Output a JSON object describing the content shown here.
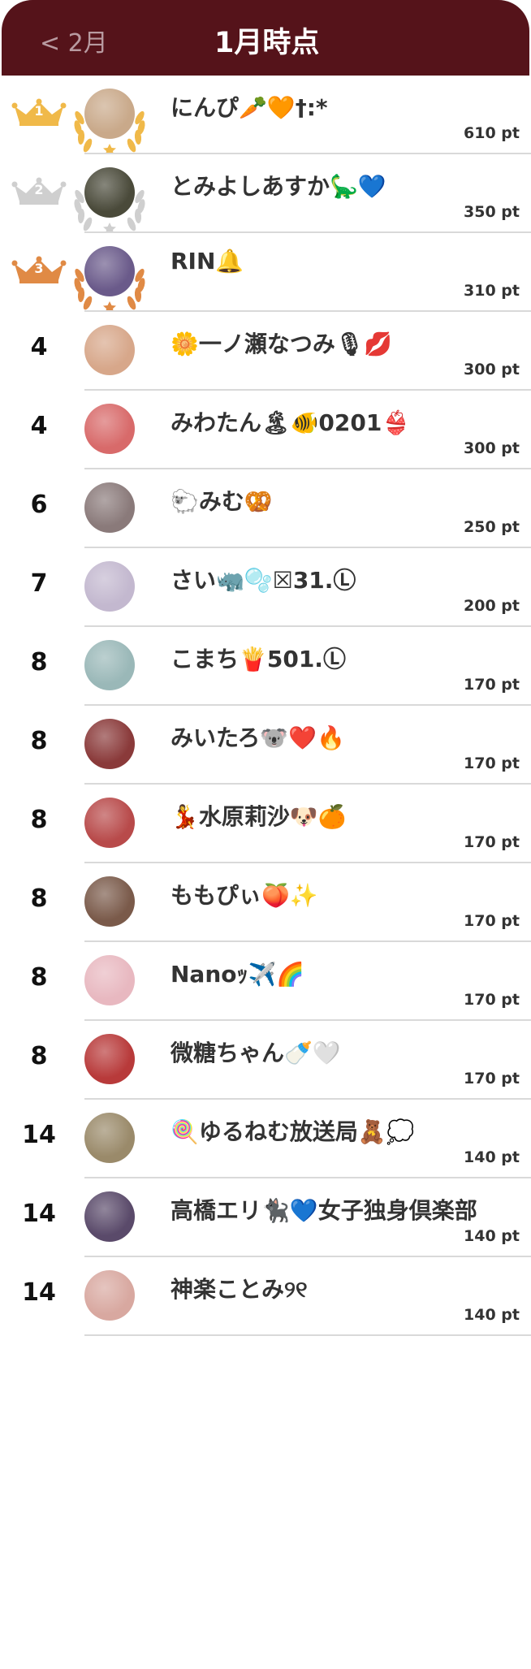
{
  "header": {
    "back_label": "< 2月",
    "title": "1月時点"
  },
  "colors": {
    "header_bg": "#55131a",
    "gold": "#f0b949",
    "silver": "#cfcfcf",
    "bronze": "#e08a45"
  },
  "ranking": [
    {
      "rank": "1",
      "medal": "gold",
      "name": "にんぴ🥕🧡†:*",
      "points": "610 pt",
      "avatar_color": "#c9a98a"
    },
    {
      "rank": "2",
      "medal": "silver",
      "name": "とみよしあすか🦕💙",
      "points": "350 pt",
      "avatar_color": "#4a4a3a"
    },
    {
      "rank": "3",
      "medal": "bronze",
      "name": "RIN🔔",
      "points": "310 pt",
      "avatar_color": "#6a5a8a"
    },
    {
      "rank": "4",
      "name": "🌼一ノ瀬なつみ🎙💋",
      "points": "300 pt",
      "avatar_color": "#d7a78a"
    },
    {
      "rank": "4",
      "name": "みわたん🏝🐠0201👙",
      "points": "300 pt",
      "avatar_color": "#d86a6a"
    },
    {
      "rank": "6",
      "name": "🐑みむ🥨",
      "points": "250 pt",
      "avatar_color": "#8a7a7a"
    },
    {
      "rank": "7",
      "name": "さい🦏🫧☒31.Ⓛ",
      "points": "200 pt",
      "avatar_color": "#c3b8cf"
    },
    {
      "rank": "8",
      "name": "こまち🍟501.Ⓛ",
      "points": "170 pt",
      "avatar_color": "#9ab8b8"
    },
    {
      "rank": "8",
      "name": "みいたろ🐨❤️🔥",
      "points": "170 pt",
      "avatar_color": "#8a3a3a"
    },
    {
      "rank": "8",
      "name": "💃水原莉沙🐶🍊",
      "points": "170 pt",
      "avatar_color": "#b84a4a"
    },
    {
      "rank": "8",
      "name": "ももぴぃ🍑✨",
      "points": "170 pt",
      "avatar_color": "#7a5a4a"
    },
    {
      "rank": "8",
      "name": "Nanoｯ✈️🌈",
      "points": "170 pt",
      "avatar_color": "#e8b8c0"
    },
    {
      "rank": "8",
      "name": "微糖ちゃん🍼🤍",
      "points": "170 pt",
      "avatar_color": "#b83a3a"
    },
    {
      "rank": "14",
      "name": "🍭ゆるねむ放送局🧸💭",
      "points": "140 pt",
      "avatar_color": "#9a8a6a"
    },
    {
      "rank": "14",
      "name": "高橋エリ🐈‍⬛💙女子独身倶楽部",
      "points": "140 pt",
      "avatar_color": "#5a4a6a"
    },
    {
      "rank": "14",
      "name": "神楽ことみ୨୧",
      "points": "140 pt",
      "avatar_color": "#d8a8a0"
    }
  ]
}
